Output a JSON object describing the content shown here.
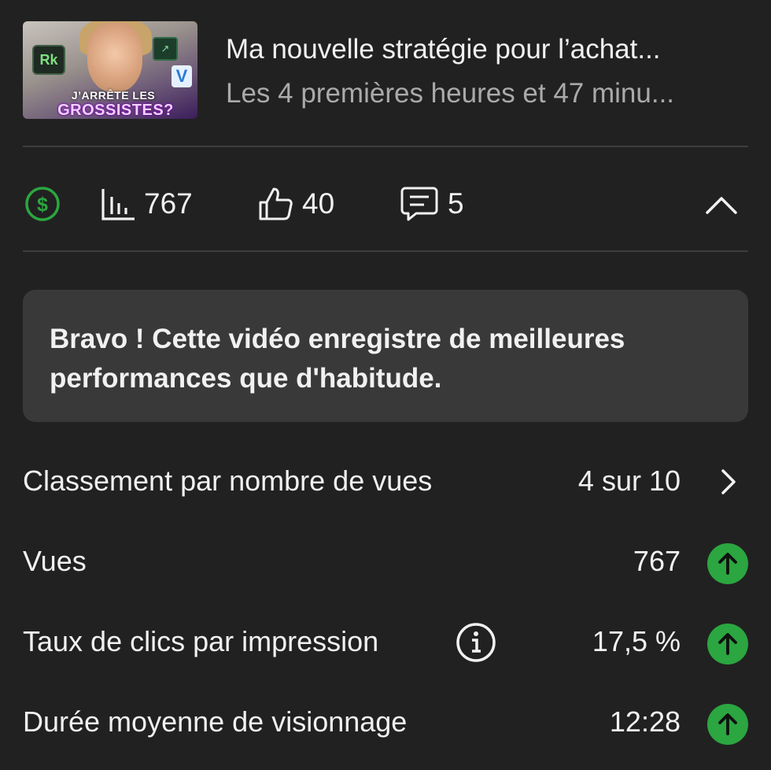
{
  "video": {
    "title": "Ma nouvelle stratégie pour l’achat...",
    "subtitle": "Les 4 premières heures et 47 minu...",
    "thumbnail": {
      "logo_text": "Rk",
      "caption_line1": "J’ARRÊTE LES",
      "caption_line2": "GROSSISTES?",
      "badge_v": "V"
    }
  },
  "stats": {
    "monetization_icon": "dollar-circle-icon",
    "views": "767",
    "likes": "40",
    "comments": "5"
  },
  "banner": {
    "text": "Bravo ! Cette vidéo enregistre de meilleures performances que d'habitude."
  },
  "metrics": [
    {
      "label": "Classement par nombre de vues",
      "value": "4 sur 10"
    },
    {
      "label": "Vues",
      "value": "767"
    },
    {
      "label": "Taux de clics par impression",
      "value": "17,5 %"
    },
    {
      "label": "Durée moyenne de visionnage",
      "value": "12:28"
    }
  ],
  "colors": {
    "background": "#212121",
    "accent_green": "#2ba640",
    "banner_bg": "#393939",
    "secondary_text": "#aaaaaa"
  }
}
